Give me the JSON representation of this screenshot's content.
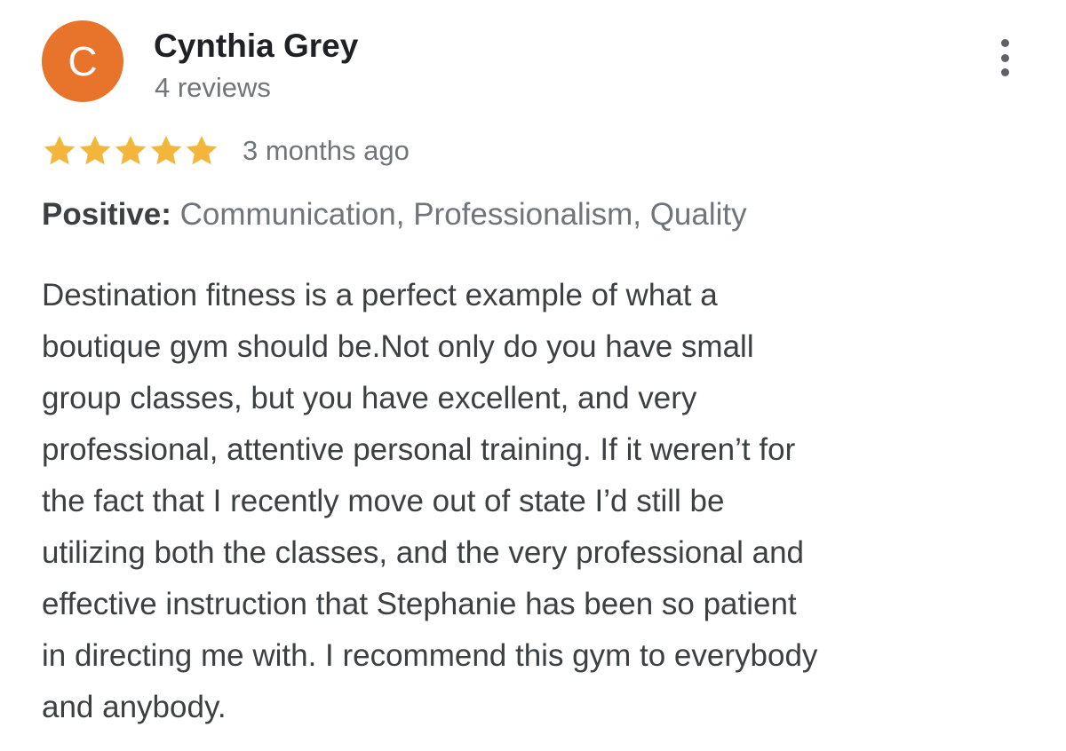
{
  "review": {
    "avatar_initial": "C",
    "avatar_color": "#e8742b",
    "reviewer_name": "Cynthia Grey",
    "review_count": "4 reviews",
    "menu_icon": "more-vert-icon",
    "rating": 5,
    "rating_max": 5,
    "star_color": "#f2b63b",
    "date": "3 months ago",
    "highlights_label": "Positive:",
    "highlights_value": " Communication, Professionalism, Quality",
    "text_lines": [
      "Destination fitness is a perfect example of what a",
      "boutique gym should be.Not only do you have small",
      "group classes, but you have excellent, and very",
      "professional, attentive personal training. If it weren’t for",
      "the fact that I recently move out of state I’d still be",
      "utilizing both the classes, and the very professional and",
      "effective instruction that Stephanie has been so patient",
      "in directing me with. I recommend this gym to everybody",
      "and anybody."
    ]
  }
}
